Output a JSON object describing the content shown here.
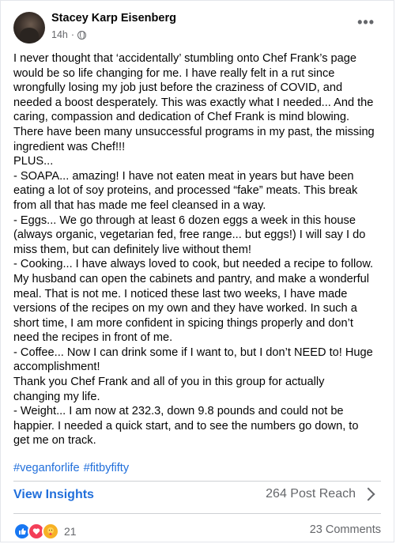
{
  "post": {
    "author": "Stacey Karp Eisenberg",
    "time": "14h",
    "separator": "·",
    "more_label": "•••",
    "lines": [
      "I never thought that ‘accidentally’ stumbling onto Chef Frank’s page",
      "would be so life changing for me. I have really felt in a rut since",
      "wrongfully losing my job just before the craziness of COVID, and",
      "needed a boost desperately. This was exactly what I needed... And the",
      "caring, compassion and dedication of Chef Frank is mind blowing.",
      "There have been many unsuccessful programs in my past, the missing",
      "ingredient was Chef!!!",
      "PLUS...",
      "- SOAPA... amazing! I have not eaten meat in years but have been",
      "eating a lot of soy proteins, and processed “fake” meats. This break",
      "from all that has made me feel cleansed in a way.",
      "- Eggs... We go through at least 6 dozen eggs a week in this house",
      "(always organic, vegetarian fed, free range... but eggs!) I will say I do",
      "miss them, but can definitely live without them!",
      "- Cooking... I have always loved to cook, but needed a recipe to follow.",
      "My husband can open the cabinets and pantry, and make a wonderful",
      "meal. That is not me. I noticed these last two weeks, I have made",
      "versions of the recipes on my own and they have worked. In such a",
      "short time, I am more confident in spicing things properly and don’t",
      "need the recipes in front of me.",
      "- Coffee... Now I can drink some if I want to, but I don’t NEED to! Huge",
      "accomplishment!",
      "Thank you Chef Frank and all of you in this group for actually",
      "changing my life.",
      "- Weight... I am now at 232.3, down 9.8 pounds and could not be",
      "happier. I needed a quick start, and to see the numbers go down, to",
      "get me on track."
    ],
    "hashtags": [
      "#veganforlife",
      "#fitbyfifty"
    ]
  },
  "footer": {
    "insights_label": "View Insights",
    "reach_label": "264 Post Reach",
    "reaction_count": "21",
    "comments_label": "23 Comments",
    "reactions": [
      "like-icon",
      "love-icon",
      "care-icon"
    ]
  },
  "colors": {
    "link": "#216fdb",
    "muted": "#65676b",
    "like": "#1877f2",
    "love": "#f33e58",
    "care": "#f7b125"
  }
}
